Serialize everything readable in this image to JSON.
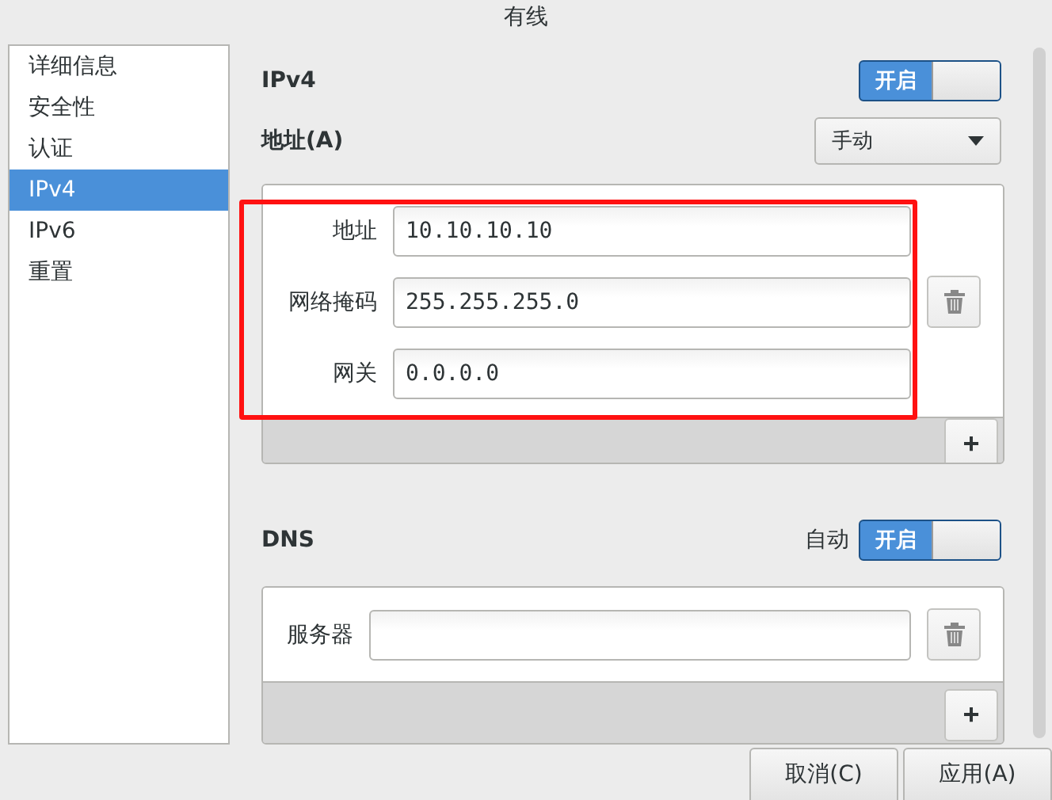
{
  "window": {
    "title": "有线"
  },
  "sidebar": {
    "items": [
      {
        "label": "详细信息",
        "selected": false
      },
      {
        "label": "安全性",
        "selected": false
      },
      {
        "label": "认证",
        "selected": false
      },
      {
        "label": "IPv4",
        "selected": true
      },
      {
        "label": "IPv6",
        "selected": false
      },
      {
        "label": "重置",
        "selected": false
      }
    ]
  },
  "ipv4": {
    "title": "IPv4",
    "switch": {
      "label": "开启",
      "on": true
    },
    "address_label": "地址(A)",
    "method": "手动",
    "address_rows": [
      {
        "label": "地址",
        "value": "10.10.10.10"
      },
      {
        "label": "网络掩码",
        "value": "255.255.255.0"
      },
      {
        "label": "网关",
        "value": "0.0.0.0"
      }
    ],
    "add_button": "+"
  },
  "dns": {
    "title": "DNS",
    "auto_label": "自动",
    "switch": {
      "label": "开启",
      "on": true
    },
    "server_label": "服务器",
    "add_button": "+"
  },
  "buttons": [
    "取消(C)",
    "应用(A)"
  ]
}
